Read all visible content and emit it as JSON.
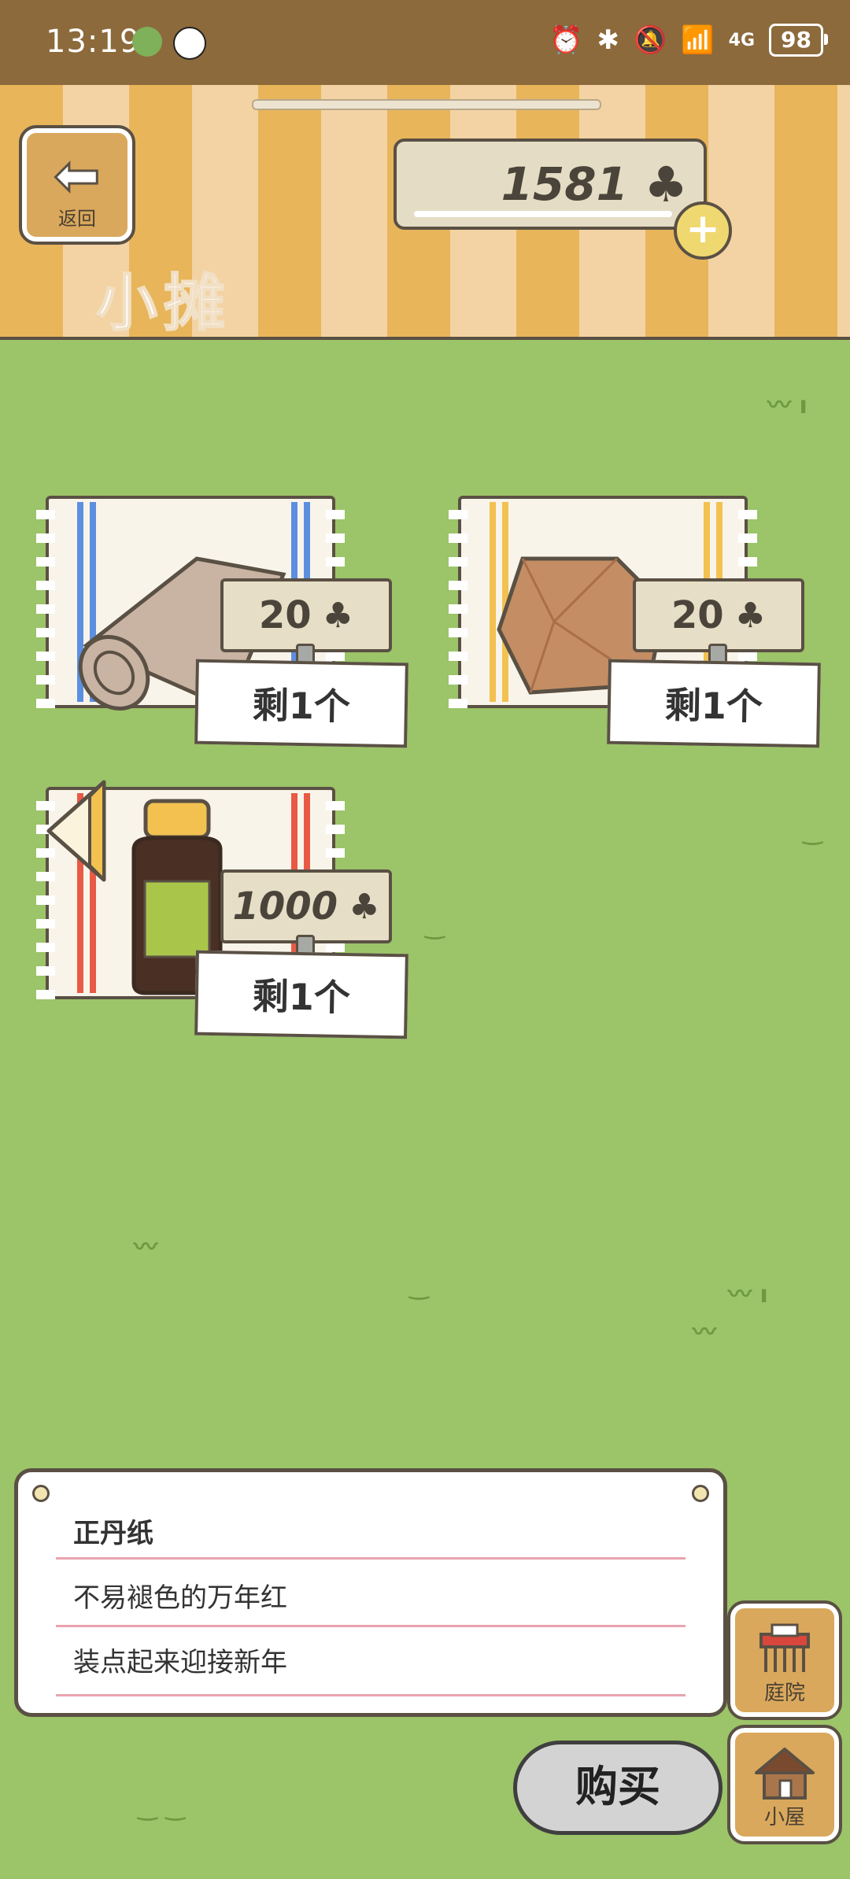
{
  "status_bar": {
    "time": "13:19",
    "battery": "98",
    "network": "4G"
  },
  "header": {
    "back_label": "返回",
    "title": "小摊",
    "currency_value": "1581",
    "currency_icon": "clover-icon"
  },
  "items": [
    {
      "name": "cloth-roll",
      "price": "20",
      "stock": "剩1个",
      "stripe_color": "#5b8fe0"
    },
    {
      "name": "paper-bag",
      "price": "20",
      "stock": "剩1个",
      "stripe_color": "#f2c150"
    },
    {
      "name": "bottle",
      "price": "1000",
      "stock": "剩1个",
      "stripe_color": "#e85a45"
    }
  ],
  "description": {
    "lines": [
      "正丹纸",
      "不易褪色的万年红",
      "装点起来迎接新年"
    ]
  },
  "side_buttons": {
    "yard_label": "庭院",
    "house_label": "小屋"
  },
  "buy_label": "购买",
  "colors": {
    "grass": "#9cc468",
    "awning_dark": "#e8b55a",
    "awning_light": "#f3d3a3",
    "wood": "#d9a85c"
  }
}
